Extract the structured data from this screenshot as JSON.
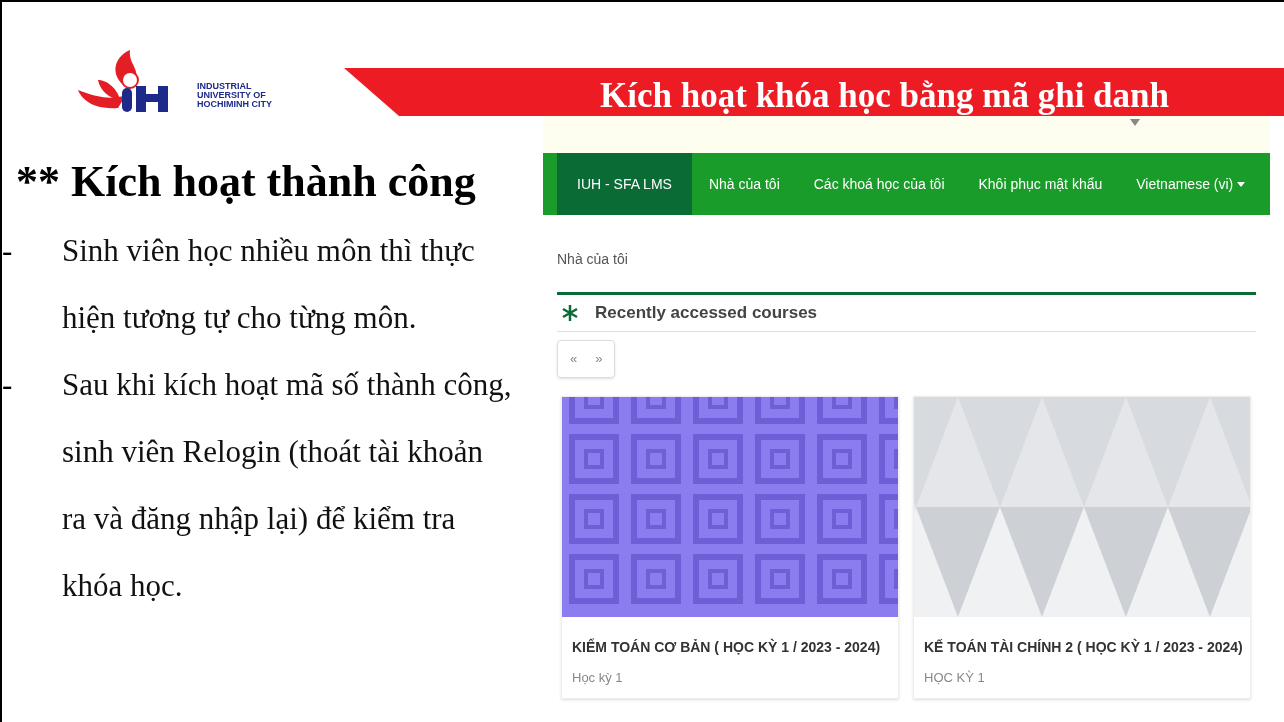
{
  "logo": {
    "lines": [
      "INDUSTRIAL",
      "UNIVERSITY OF",
      "HOCHIMINH CITY"
    ]
  },
  "banner": {
    "title": "Kích hoạt khóa học bằng mã ghi danh"
  },
  "heading": "** Kích hoạt thành công",
  "bullets": [
    {
      "marker": "-",
      "text": "Sinh viên học nhiều môn thì thực hiện tương tự cho từng môn."
    },
    {
      "marker": "-",
      "text": "Sau khi kích hoạt mã số thành công, sinh viên Relogin (thoát tài khoản ra và đăng nhập lại) để kiểm tra khóa học."
    }
  ],
  "lms": {
    "navbar": [
      {
        "label": "IUH - SFA LMS",
        "selected": true
      },
      {
        "label": "Nhà của tôi",
        "selected": false
      },
      {
        "label": "Các khoá học của tôi",
        "selected": false
      },
      {
        "label": "Khôi phục mật khẩu",
        "selected": false
      },
      {
        "label": "Vietnamese (vi)",
        "selected": false,
        "dropdown": true
      }
    ],
    "breadcrumb": "Nhà của tôi",
    "section_title": "Recently accessed courses",
    "pager": [
      "«",
      "»"
    ],
    "courses": [
      {
        "kind": "squares",
        "title": "KIỂM TOÁN CƠ BẢN ( HỌC KỲ 1 / 2023 - 2024)",
        "term": "Học kỳ 1"
      },
      {
        "kind": "triangles",
        "title": "KẾ TOÁN TÀI CHÍNH 2 ( HỌC KỲ 1 / 2023 - 2024)",
        "term": "HỌC KỲ 1"
      }
    ]
  }
}
